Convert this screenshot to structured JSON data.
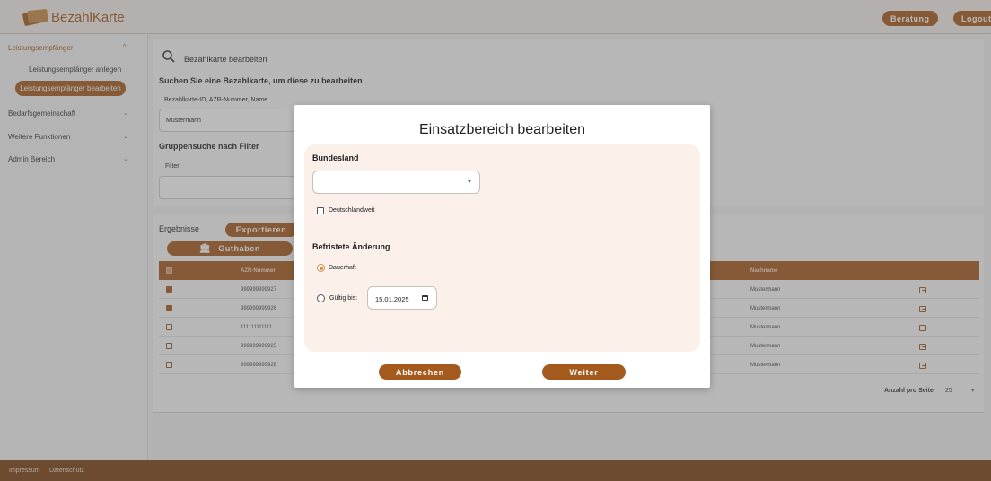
{
  "header": {
    "brand": "BezahlKarte",
    "beratung_label": "Beratung",
    "logout_label": "Logout"
  },
  "sidebar": {
    "items": [
      {
        "label": "Leistungsempfänger",
        "expanded": true
      },
      {
        "label": "Leistungsempfänger anlegen"
      },
      {
        "label": "Leistungsempfänger bearbeiten",
        "active": true
      },
      {
        "label": "Bedarfsgemeinschaft"
      },
      {
        "label": "Weitere Funktionen"
      },
      {
        "label": "Admin Bereich"
      }
    ]
  },
  "main": {
    "page_title": "Bezahlkarte bearbeiten",
    "search_heading": "Suchen Sie eine Bezahlkarte, um diese zu bearbeiten",
    "search_field_label": "Bezahlkarte-ID, AZR-Nummer, Name",
    "search_value": "Mustermann",
    "group_heading": "Gruppensuche nach Filter",
    "filter_label": "Filter",
    "results_label": "Ergebnisse",
    "export_label": "Exportieren",
    "guthaben_label": "Guthaben",
    "columns": {
      "azr": "AZR-Nummer",
      "nachname": "Nachname"
    },
    "rows": [
      {
        "azr": "999999999927",
        "nachname": "Mustermann",
        "checked": true
      },
      {
        "azr": "999999999926",
        "nachname": "Mustermann",
        "checked": true
      },
      {
        "azr": "111111111111",
        "nachname": "Mustermann",
        "checked": false
      },
      {
        "azr": "999999999925",
        "nachname": "Mustermann",
        "checked": false
      },
      {
        "azr": "999999999928",
        "nachname": "Mustermann",
        "checked": false
      }
    ],
    "page_size_label": "Anzahl pro Seite",
    "page_size_value": "25"
  },
  "modal": {
    "title": "Einsatzbereich bearbeiten",
    "bundesland_label": "Bundesland",
    "bundesland_value": "",
    "deutschlandweit_label": "Deutschlandweit",
    "befristete_label": "Befristete Änderung",
    "dauerhaft_label": "Dauerhaft",
    "gueltig_label": "Gültig bis:",
    "date_value": "15.01.2025",
    "cancel_label": "Abbrechen",
    "next_label": "Weiter"
  },
  "footer": {
    "impressum": "Impressum",
    "datenschutz": "Datenschutz"
  },
  "colors": {
    "brand": "#a55a1d",
    "footer": "#7b4113",
    "modal_panel": "#fbf0ea",
    "radio_accent": "#d9883f"
  }
}
